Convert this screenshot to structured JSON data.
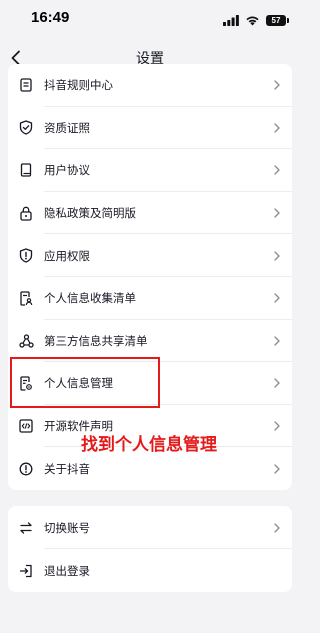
{
  "status": {
    "time": "16:49",
    "battery": "57"
  },
  "nav": {
    "title": "设置"
  },
  "group1": {
    "items": [
      {
        "label": "抖音规则中心",
        "icon": "rules-icon"
      },
      {
        "label": "资质证照",
        "icon": "shield-check-icon"
      },
      {
        "label": "用户协议",
        "icon": "book-icon"
      },
      {
        "label": "隐私政策及简明版",
        "icon": "lock-icon"
      },
      {
        "label": "应用权限",
        "icon": "shield-alert-icon"
      },
      {
        "label": "个人信息收集清单",
        "icon": "document-person-icon"
      },
      {
        "label": "第三方信息共享清单",
        "icon": "share-nodes-icon"
      },
      {
        "label": "个人信息管理",
        "icon": "document-gear-icon"
      },
      {
        "label": "开源软件声明",
        "icon": "code-icon"
      },
      {
        "label": "关于抖音",
        "icon": "info-icon"
      }
    ]
  },
  "group2": {
    "items": [
      {
        "label": "切换账号",
        "icon": "switch-arrows-icon"
      },
      {
        "label": "退出登录",
        "icon": "logout-icon"
      }
    ]
  },
  "annotation": {
    "text": "找到个人信息管理"
  },
  "colors": {
    "highlight": "#e41b1b",
    "background": "#f3f3f5",
    "card": "#ffffff",
    "text": "#161823"
  }
}
